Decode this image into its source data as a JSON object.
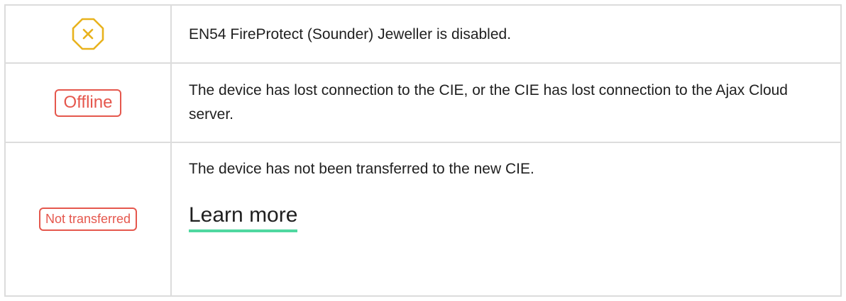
{
  "rows": [
    {
      "status_icon": "octagon-x-icon",
      "text": "EN54 FireProtect (Sounder) Jeweller is disabled."
    },
    {
      "badge": "Offline",
      "text": "The device has lost connection to the CIE, or the CIE has lost connection to the Ajax Cloud server."
    },
    {
      "badge": "Not transferred",
      "text": "The device has not been transferred to the new CIE.",
      "link": "Learn more"
    }
  ],
  "colors": {
    "border": "#dcdcdc",
    "badge_red": "#e5574d",
    "icon_amber": "#e8b21d",
    "link_underline": "#4fd8a0",
    "text": "#1f1f1f"
  }
}
